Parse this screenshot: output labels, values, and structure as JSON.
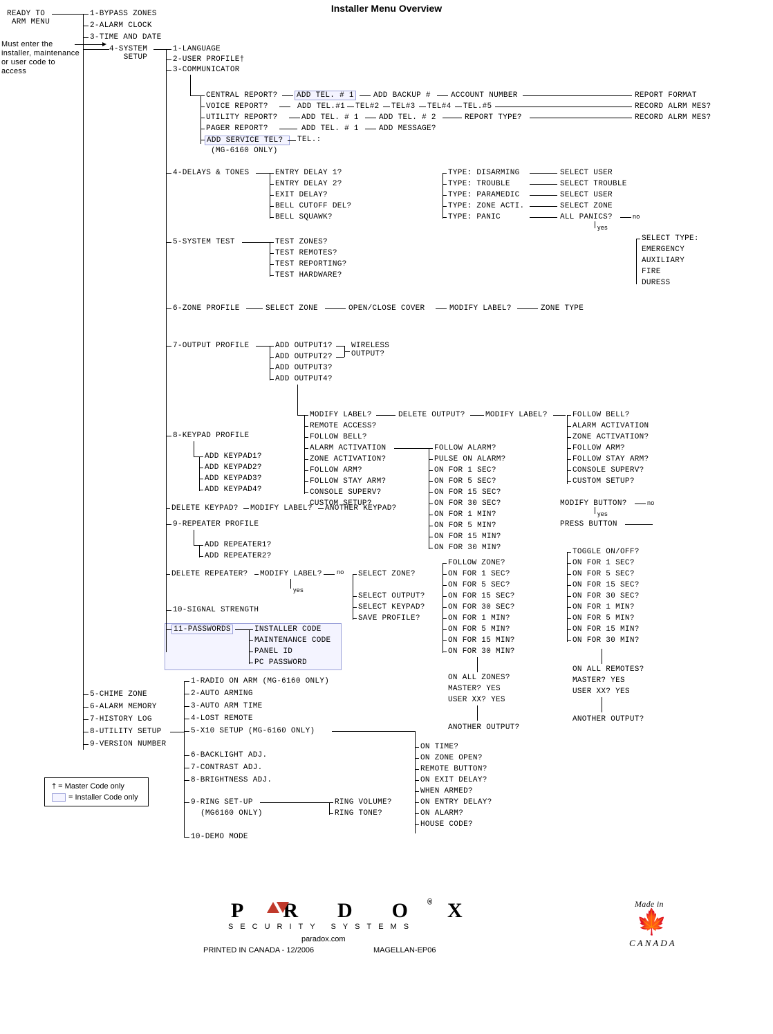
{
  "title": "Installer Menu Overview",
  "root": "READY TO\n ARM MENU",
  "access_note": "Must enter the\ninstaller, maintenance\nor user code to\naccess",
  "legend": {
    "master": "† = Master Code only",
    "installer": "= Installer Code only"
  },
  "lvl1": {
    "bypass": "1-BYPASS ZONES",
    "alarm_clock": "2-ALARM CLOCK",
    "time_date": "3-TIME AND DATE",
    "system_setup": "4-SYSTEM\n   SETUP",
    "chime": "5-CHIME ZONE",
    "alarm_mem": "6-ALARM MEMORY",
    "history": "7-HISTORY LOG",
    "utility": "8-UTILITY SETUP",
    "version": "9-VERSION NUMBER"
  },
  "sys": {
    "lang": "1-LANGUAGE",
    "user_profile": "2-USER PROFILE†",
    "communicator": "3-COMMUNICATOR",
    "delays": "4-DELAYS & TONES",
    "system_test": "5-SYSTEM TEST",
    "zone_profile": "6-ZONE PROFILE",
    "output_profile": "7-OUTPUT PROFILE",
    "keypad_profile": "8-KEYPAD PROFILE",
    "repeater_profile": "9-REPEATER PROFILE",
    "signal": "10-SIGNAL STRENGTH",
    "passwords": "11-PASSWORDS"
  },
  "comm": {
    "central": "CENTRAL REPORT?",
    "voice": "VOICE REPORT?",
    "utility": "UTILITY REPORT?",
    "pager": "PAGER REPORT?",
    "service": "ADD SERVICE TEL?",
    "service_sub": "(MG-6160 ONLY)",
    "add_tel1_box": "ADD TEL. # 1",
    "add_backup": "ADD BACKUP #",
    "account": "ACCOUNT NUMBER",
    "report_format": "REPORT FORMAT",
    "add_tel1": "ADD TEL.#1",
    "tel2": "TEL#2",
    "tel3": "TEL#3",
    "tel4": "TEL#4",
    "tel5": "TEL.#5",
    "record1": "RECORD ALRM MES?",
    "util_add1": "ADD TEL. # 1",
    "util_add2": "ADD TEL. # 2",
    "report_type": "REPORT TYPE?",
    "record2": "RECORD ALRM MES?",
    "pager_add1": "ADD TEL. # 1",
    "add_message": "ADD MESSAGE?",
    "tel_colon": "TEL.:"
  },
  "delays": {
    "e1": "ENTRY DELAY 1?",
    "e2": "ENTRY DELAY 2?",
    "exit": "EXIT DELAY?",
    "bell_cutoff": "BELL CUTOFF DEL?",
    "squawk": "BELL SQUAWK?"
  },
  "types": {
    "disarm": "TYPE: DISARMING",
    "trouble": "TYPE: TROUBLE",
    "paramedic": "TYPE: PARAMEDIC",
    "zone_acti": "TYPE: ZONE ACTI.",
    "panic": "TYPE: PANIC",
    "sel_user": "SELECT USER",
    "sel_trouble": "SELECT TROUBLE",
    "sel_user2": "SELECT USER",
    "sel_zone": "SELECT ZONE",
    "all_panics": "ALL PANICS?",
    "no": "no",
    "yes": "yes",
    "select_type": "SELECT TYPE:",
    "emergency": "EMERGENCY",
    "aux": "AUXILIARY",
    "fire": "FIRE",
    "duress": "DURESS"
  },
  "test": {
    "zones": "TEST ZONES?",
    "remotes": "TEST REMOTES?",
    "reporting": "TEST REPORTING?",
    "hardware": "TEST HARDWARE?"
  },
  "zone_profile_row": {
    "sel_zone": "SELECT ZONE",
    "open_close": "OPEN/CLOSE COVER",
    "modify": "MODIFY LABEL?",
    "zone_type": "ZONE TYPE"
  },
  "output": {
    "add1": "ADD OUTPUT1?",
    "add2": "ADD OUTPUT2?",
    "add3": "ADD OUTPUT3?",
    "add4": "ADD OUTPUT4?",
    "wireless": "WIRELESS\nOUTPUT?",
    "modify1": "MODIFY LABEL?",
    "delete": "DELETE OUTPUT?",
    "modify2": "MODIFY LABEL?",
    "remote_access": "REMOTE ACCESS?",
    "follow_bell": "FOLLOW BELL?",
    "alarm_act": "ALARM ACTIVATION",
    "zone_act": "ZONE ACTIVATION?",
    "follow_arm": "FOLLOW ARM?",
    "follow_stay": "FOLLOW STAY ARM?",
    "console": "CONSOLE SUPERV?",
    "custom": "CUSTOM SETUP?",
    "right_list": {
      "follow_bell": "FOLLOW BELL?",
      "alarm_act": "ALARM ACTIVATION",
      "zone_act": "ZONE ACTIVATION?",
      "follow_arm": "FOLLOW ARM?",
      "follow_stay": "FOLLOW STAY ARM?",
      "console": "CONSOLE SUPERV?",
      "custom": "CUSTOM SETUP?"
    },
    "follow_alarm": "FOLLOW ALARM?",
    "pulse": "PULSE ON ALARM?",
    "on1s": "ON FOR 1 SEC?",
    "on5s": "ON FOR 5 SEC?",
    "on15s": "ON FOR 15 SEC?",
    "on30s": "ON FOR 30 SEC?",
    "on1m": "ON FOR 1 MIN?",
    "on5m": "ON FOR 5 MIN?",
    "on15m": "ON FOR 15 MIN?",
    "on30m": "ON FOR 30 MIN?",
    "modify_button": "MODIFY BUTTON?",
    "press_button": "PRESS BUTTON",
    "no2": "no",
    "yes2": "yes"
  },
  "keypad": {
    "add1": "ADD KEYPAD1?",
    "add2": "ADD KEYPAD2?",
    "add3": "ADD KEYPAD3?",
    "add4": "ADD KEYPAD4?",
    "delete": "DELETE KEYPAD?",
    "modify": "MODIFY LABEL?",
    "another": "ANOTHER KEYPAD?"
  },
  "repeater": {
    "add1": "ADD REPEATER1?",
    "add2": "ADD REPEATER2?",
    "delete": "DELETE REPEATER?",
    "modify": "MODIFY LABEL?",
    "no": "no",
    "yes": "yes",
    "select_zone": "SELECT ZONE?",
    "select_output": "SELECT OUTPUT?",
    "select_keypad": "SELECT KEYPAD?",
    "save": "SAVE PROFILE?"
  },
  "follow_zone_list": {
    "fz": "FOLLOW ZONE?",
    "on1s": "ON FOR 1 SEC?",
    "on5s": "ON FOR 5 SEC?",
    "on15s": "ON FOR 15 SEC?",
    "on30s": "ON FOR 30 SEC?",
    "on1m": "ON FOR 1 MIN?",
    "on5m": "ON FOR 5 MIN?",
    "on15m": "ON FOR 15 MIN?",
    "on30m": "ON FOR 30 MIN?"
  },
  "toggle_list": {
    "toggle": "TOGGLE ON/OFF?",
    "on1s": "ON FOR 1 SEC?",
    "on5s": "ON FOR 5 SEC?",
    "on15s": "ON FOR 15 SEC?",
    "on30s": "ON FOR 30 SEC?",
    "on1m": "ON FOR 1 MIN?",
    "on5m": "ON FOR 5 MIN?",
    "on15m": "ON FOR 15 MIN?",
    "on30m": "ON FOR 30 MIN?"
  },
  "on_all_zones": {
    "q": "ON ALL ZONES?",
    "master": "MASTER? YES",
    "user": "USER XX? YES",
    "another": "ANOTHER OUTPUT?"
  },
  "on_all_remotes": {
    "q": "ON ALL REMOTES?",
    "master": "MASTER? YES",
    "user": "USER XX? YES",
    "another": "ANOTHER OUTPUT?"
  },
  "passwords": {
    "installer": "INSTALLER CODE",
    "maint": "MAINTENANCE CODE",
    "panel": "PANEL ID",
    "pc": "PC PASSWORD"
  },
  "utility_list": {
    "i1": "1-RADIO ON ARM (MG-6160 ONLY)",
    "i2": "2-AUTO ARMING",
    "i3": "3-AUTO ARM TIME",
    "i4": "4-LOST REMOTE",
    "i5": "5-X10 SETUP (MG-6160 ONLY)",
    "i6": "6-BACKLIGHT ADJ.",
    "i7": "7-CONTRAST ADJ.",
    "i8": "8-BRIGHTNESS ADJ.",
    "i9": "9-RING SET-UP",
    "i9sub": "(MG6160 ONLY)",
    "i10": "10-DEMO MODE",
    "ring_vol": "RING VOLUME?",
    "ring_tone": "RING TONE?"
  },
  "x10": {
    "on_time": "ON TIME?",
    "on_zone": "ON ZONE OPEN?",
    "remote_btn": "REMOTE BUTTON?",
    "on_exit": "ON EXIT DELAY?",
    "when_armed": "WHEN ARMED?",
    "on_entry": "ON ENTRY DELAY?",
    "on_alarm": "ON ALARM?",
    "house": "HOUSE CODE?"
  },
  "footer": {
    "logo_top": "P   R   D   O   X",
    "logo_sub": "SECURITY SYSTEMS",
    "site": "paradox.com",
    "print": "PRINTED IN CANADA - 12/2006",
    "model": "MAGELLAN-EP06",
    "reg": "®",
    "made_in": "Made in",
    "canada": "CANADA"
  }
}
